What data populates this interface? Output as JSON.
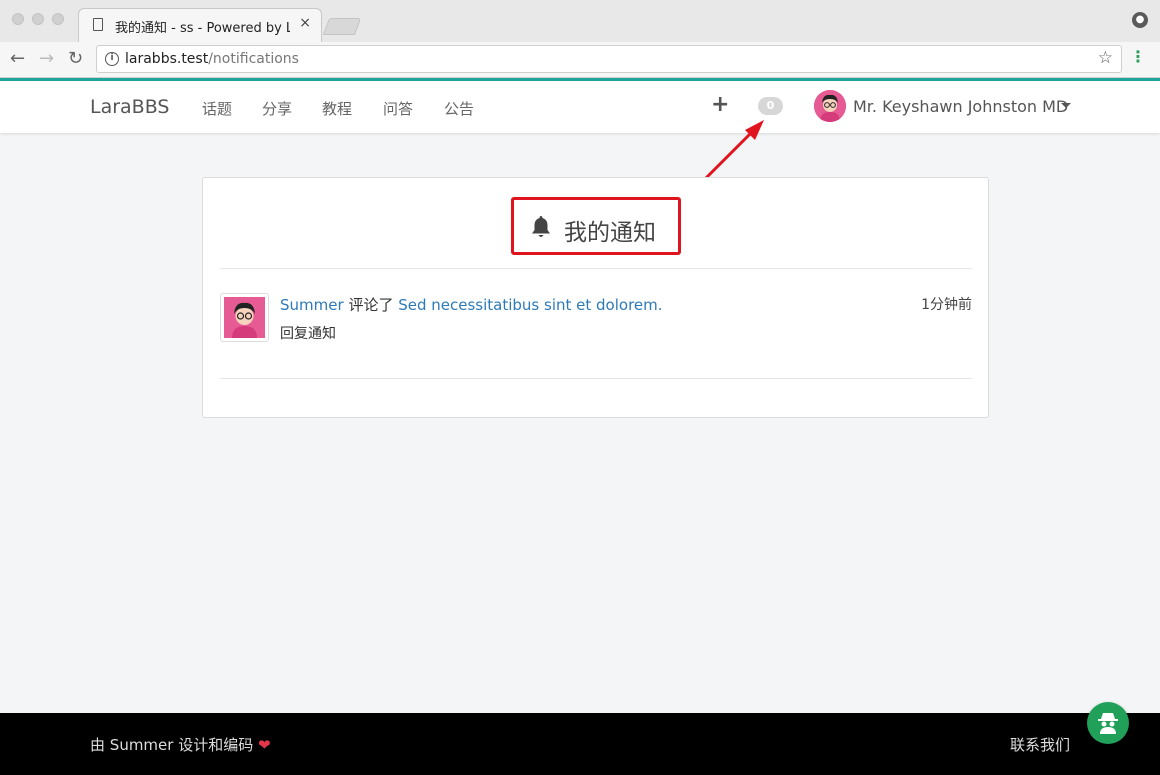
{
  "browser": {
    "tab_title": "我的通知 - ss - Powered by LaraBBS",
    "tab_close": "×",
    "url_host": "larabbs.test",
    "url_path": "/notifications"
  },
  "navbar": {
    "brand": "LaraBBS",
    "items": [
      {
        "label": "话题"
      },
      {
        "label": "分享"
      },
      {
        "label": "教程"
      },
      {
        "label": "问答"
      },
      {
        "label": "公告"
      }
    ],
    "plus_label": "+",
    "notification_count": "0",
    "user_name": "Mr. Keyshawn Johnston MD"
  },
  "panel": {
    "title": "我的通知",
    "notification": {
      "user": "Summer",
      "action": "评论了",
      "topic": "Sed necessitatibus sint et dolorem.",
      "time": "1分钟前",
      "type": "回复通知"
    }
  },
  "footer": {
    "prefix": "由",
    "author": "Summer",
    "suffix": "设计和编码",
    "heart": "❤",
    "contact": "联系我们"
  },
  "colors": {
    "accent": "#1fa59b",
    "link": "#2d7ab8",
    "highlight": "#e0141e",
    "fab": "#21a05a"
  }
}
